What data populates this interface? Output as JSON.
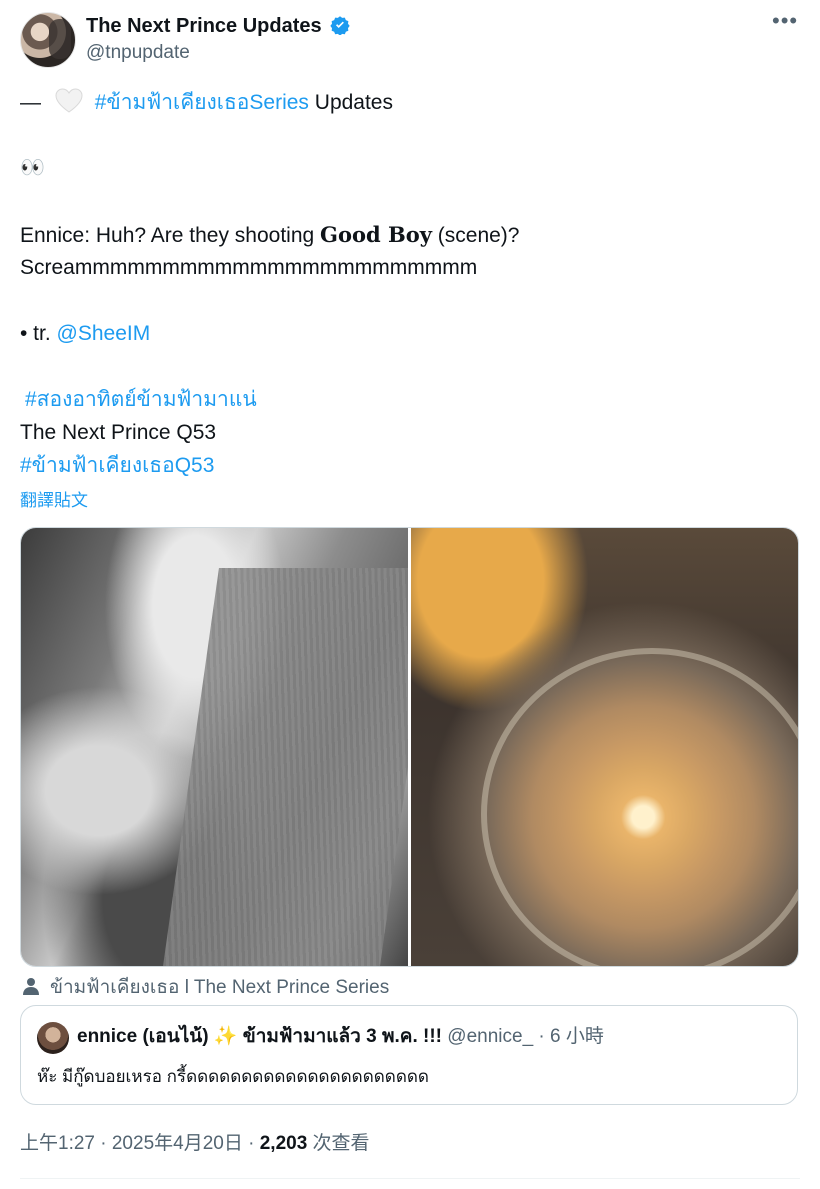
{
  "author": {
    "display_name": "The Next Prince Updates",
    "handle": "@tnpupdate",
    "verified_color": "#1d9bf0"
  },
  "tweet": {
    "lines": {
      "l1_prefix": "—",
      "l1_hashtag": "#ข้ามฟ้าเคียงเธอSeries",
      "l1_suffix": " Updates",
      "l2_emoji": "👀",
      "l3_a": "Ennice: Huh? Are they shooting ",
      "l3_bold": "Good Boy",
      "l3_b": " (scene)?",
      "l4": "Screammmmmmmmmmmmmmmmmmmmmmm",
      "l5_prefix": "• tr. ",
      "l5_link": "@SheeIM",
      "l6_hashtag": "#สองอาทิตย์ข้ามฟ้ามาแน่",
      "l7": "The Next Prince Q53",
      "l8_hashtag": "#ข้ามฟ้าเคียงเธอQ53"
    },
    "translate_label": "翻譯貼文"
  },
  "media_source": "ข้ามฟ้าเคียงเธอ l The Next Prince Series",
  "quote": {
    "name": "ennice (เอนไน้) ✨ ข้ามฟ้ามาแล้ว 3 พ.ค. !!!",
    "handle": "@ennice_",
    "time": "· 6 小時",
    "text": "ห๊ะ มีกู๊ดบอยเหรอ กรี้ดดดดดดดดดดดดดดดดดดดดดด"
  },
  "footer": {
    "time": "上午1:27 · 2025年4月20日 · ",
    "views": "2,203",
    "views_label": " 次查看"
  },
  "icons": {
    "more": "more-icon",
    "verified": "verified-badge-icon",
    "heart": "white-heart-icon",
    "person": "person-icon"
  }
}
